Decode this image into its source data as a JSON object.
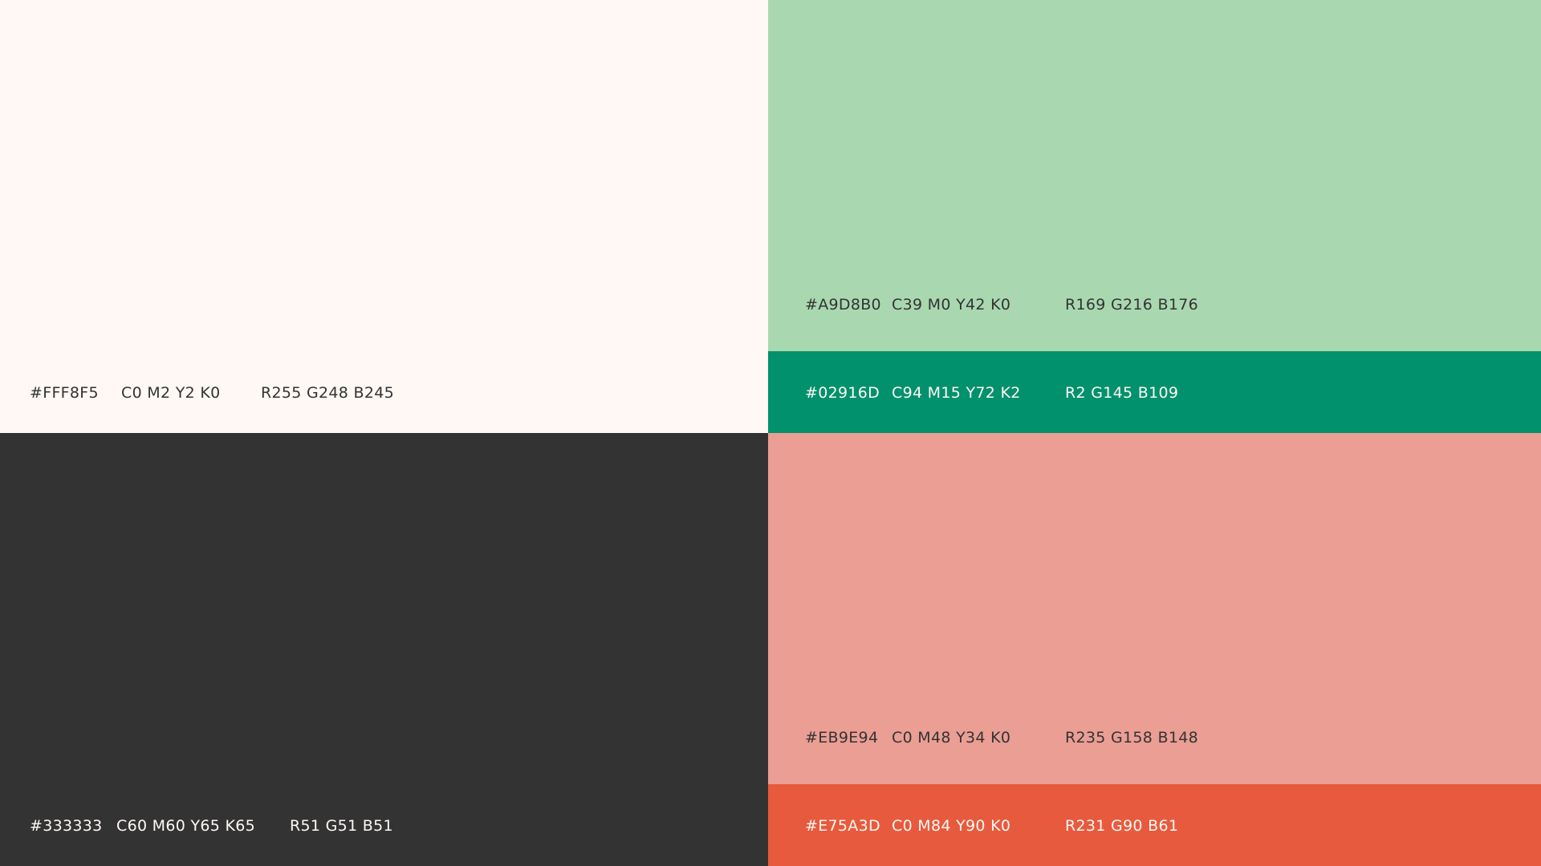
{
  "swatches": {
    "cream": {
      "color": "#FFF8F5",
      "hex": "#FFF8F5",
      "cmyk": "C0 M2 Y2 K0",
      "rgb": "R255 G248 B245"
    },
    "mint": {
      "color": "#A9D8B0",
      "hex": "#A9D8B0",
      "cmyk": "C39 M0 Y42 K0",
      "rgb": "R169 G216 B176"
    },
    "green": {
      "color": "#02916D",
      "hex": "#02916D",
      "cmyk": "C94 M15 Y72 K2",
      "rgb": "R2 G145 B109"
    },
    "dark": {
      "color": "#333333",
      "hex": "#333333",
      "cmyk": "C60 M60 Y65 K65",
      "rgb": "R51 G51 B51"
    },
    "salmon": {
      "color": "#EB9E94",
      "hex": "#EB9E94",
      "cmyk": "C0 M48 Y34 K0",
      "rgb": "R235 G158 B148"
    },
    "red": {
      "color": "#E75A3D",
      "hex": "#E75A3D",
      "cmyk": "C0 M84 Y90 K0",
      "rgb": "R231 G90 B61"
    }
  },
  "text_colors": {
    "dark": "#333333",
    "light": "#FFF8F5"
  }
}
